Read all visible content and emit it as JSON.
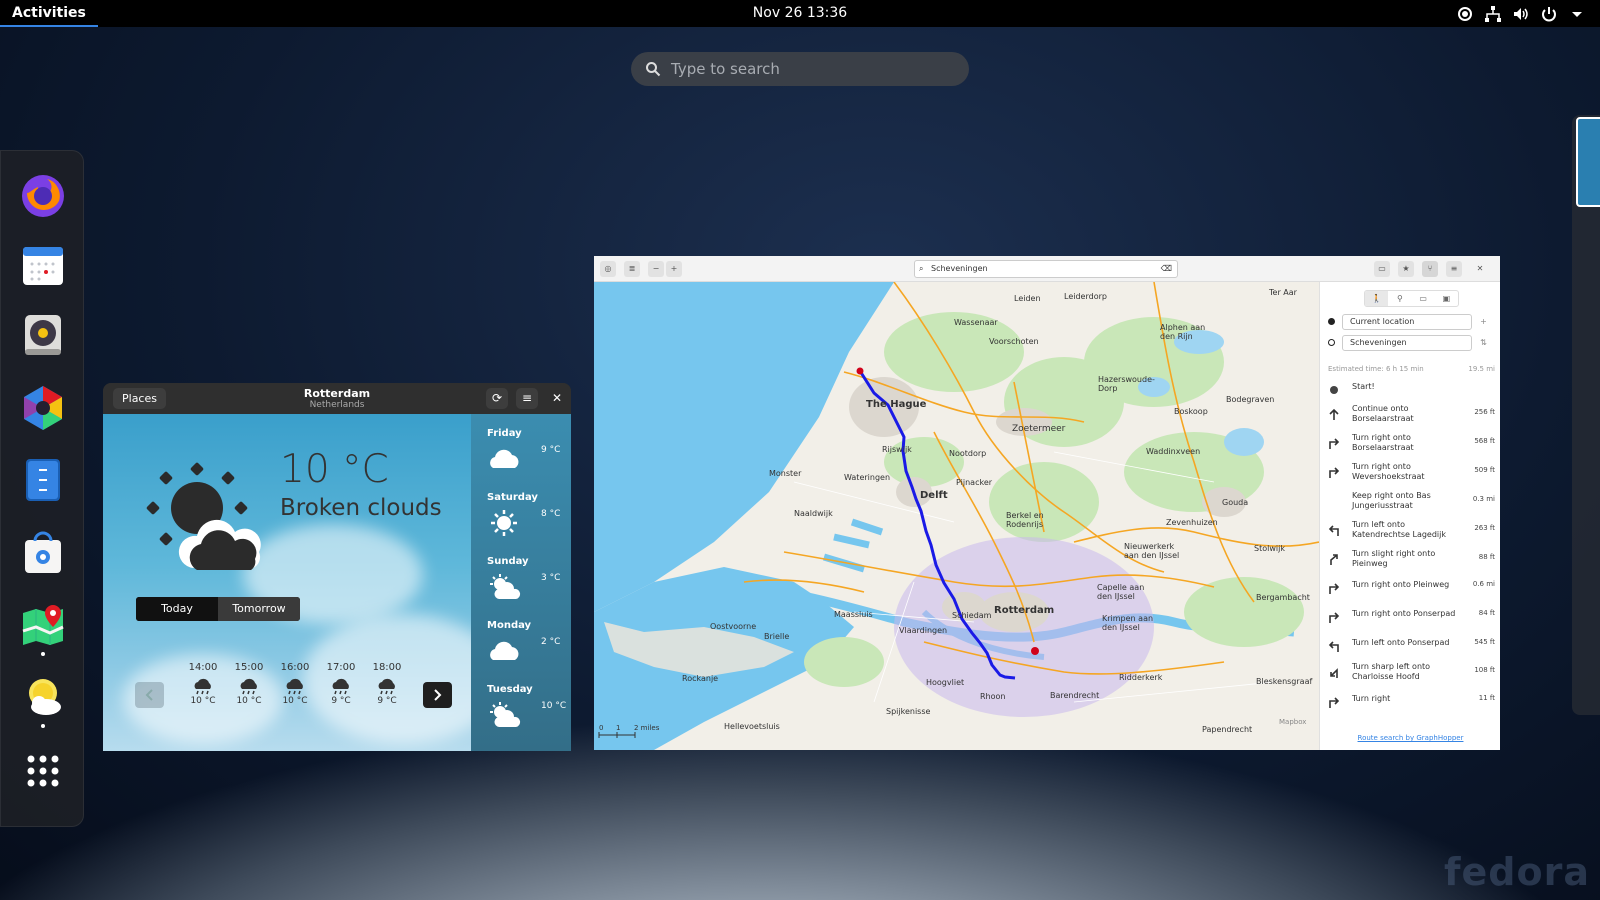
{
  "topbar": {
    "activities": "Activities",
    "clock": "Nov 26  13:36"
  },
  "overview": {
    "search_placeholder": "Type to search"
  },
  "dock": [
    "firefox-icon",
    "calendar-icon",
    "rhythmbox-icon",
    "photos-icon",
    "files-icon",
    "software-icon",
    "maps-icon",
    "weather-icon",
    "show-apps-icon"
  ],
  "weather": {
    "places_button": "Places",
    "city": "Rotterdam",
    "country": "Netherlands",
    "temperature": "10 °C",
    "condition": "Broken clouds",
    "tabs": [
      "Today",
      "Tomorrow"
    ],
    "hourly": [
      {
        "time": "14:00",
        "temp": "10 °C"
      },
      {
        "time": "15:00",
        "temp": "10 °C"
      },
      {
        "time": "16:00",
        "temp": "10 °C"
      },
      {
        "time": "17:00",
        "temp": "9 °C"
      },
      {
        "time": "18:00",
        "temp": "9 °C"
      }
    ],
    "daily": [
      {
        "day": "Friday",
        "temp": "9 °C"
      },
      {
        "day": "Saturday",
        "temp": "8 °C"
      },
      {
        "day": "Sunday",
        "temp": "3 °C"
      },
      {
        "day": "Monday",
        "temp": "2 °C"
      },
      {
        "day": "Tuesday",
        "temp": "10 °C"
      }
    ]
  },
  "maps": {
    "search_value": "Scheveningen",
    "modes": [
      "walk",
      "bike",
      "car",
      "transit"
    ],
    "from": "Current location",
    "to": "Scheveningen",
    "estimated": "Estimated time: 6 h 15 min",
    "distance": "19.5 mi",
    "steps": [
      {
        "text": "Start!",
        "dist": ""
      },
      {
        "text": "Continue onto Borselaarstraat",
        "dist": "256 ft"
      },
      {
        "text": "Turn right onto Borselaarstraat",
        "dist": "568 ft"
      },
      {
        "text": "Turn right onto Wevershoekstraat",
        "dist": "509 ft"
      },
      {
        "text": "Keep right onto Bas Jungeriusstraat",
        "dist": "0.3 mi"
      },
      {
        "text": "Turn left onto Katendrechtse Lagedijk",
        "dist": "263 ft"
      },
      {
        "text": "Turn slight right onto Pieinweg",
        "dist": "88 ft"
      },
      {
        "text": "Turn right onto Pleinweg",
        "dist": "0.6 mi"
      },
      {
        "text": "Turn right onto Ponserpad",
        "dist": "84 ft"
      },
      {
        "text": "Turn left onto Ponserpad",
        "dist": "545 ft"
      },
      {
        "text": "Turn sharp left onto Charloisse Hoofd",
        "dist": "108 ft"
      },
      {
        "text": "Turn right",
        "dist": "11 ft"
      }
    ],
    "footer": "Route search by GraphHopper",
    "places": [
      "Leiden",
      "Leiderdorp",
      "The Hague",
      "Zoetermeer",
      "Delft",
      "Rotterdam",
      "Schiedam",
      "Vlaardingen",
      "Gouda",
      "Rijswijk",
      "Wassenaar",
      "Voorschoten",
      "Nootdorp",
      "Pijnacker",
      "Wateringen",
      "Monster",
      "Naaldwijk",
      "Maassluis",
      "Brielle",
      "Oostvoorne",
      "Rockanje",
      "Hoogvliet",
      "Spijkenisse",
      "Rhoon",
      "Barendrecht",
      "Ridderkerk",
      "Capelle aan den IJssel",
      "Krimpen aan den IJssel",
      "Nieuwerkerk aan den IJssel",
      "Waddinxveen",
      "Boskoop",
      "Alphen aan den Rijn",
      "Bodegraven",
      "Hellevoetsluis",
      "Zevenhuizen",
      "Berkel en Rodenrijs",
      "Hazerswoude-Dorp",
      "Ter Aar",
      "Papendrecht",
      "Bleskensgraaf",
      "Bergambacht",
      "Stolwijk"
    ],
    "scale": [
      "0",
      "1",
      "2 miles"
    ],
    "attribution": "Mapbox"
  },
  "watermark": "fedora"
}
